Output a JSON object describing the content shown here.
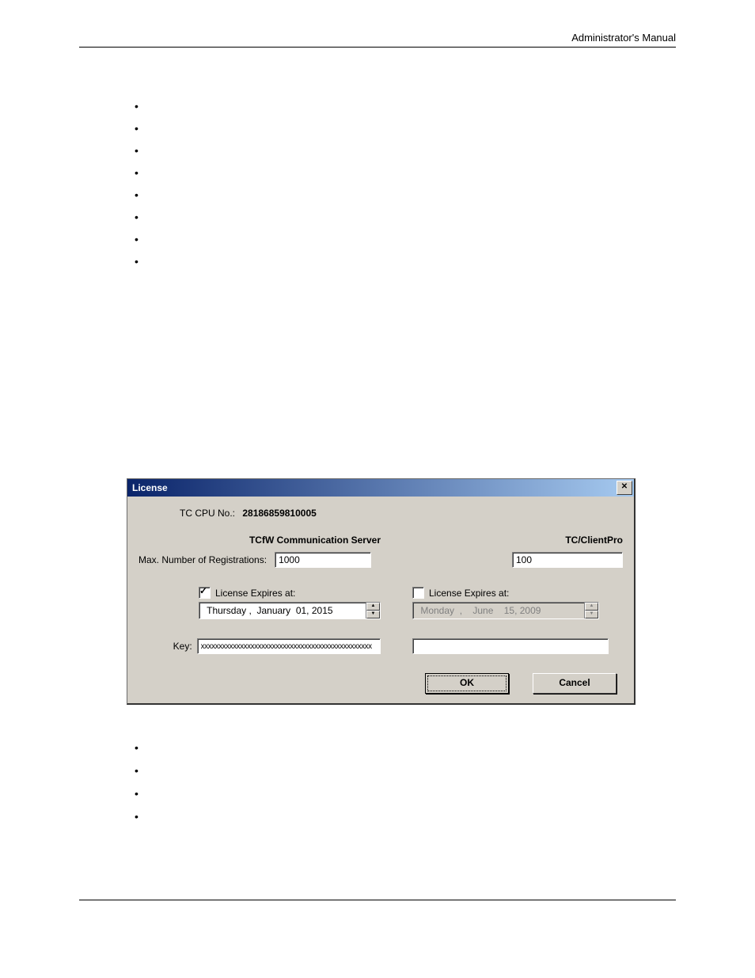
{
  "header": {
    "title": "Administrator's Manual"
  },
  "bullets_top": [
    "",
    "",
    "",
    "",
    "",
    "",
    "",
    ""
  ],
  "bullets_bottom": [
    "",
    "",
    "",
    ""
  ],
  "dialog": {
    "title": "License",
    "cpu_label": "TC CPU No.:",
    "cpu_value": "28186859810005",
    "left": {
      "title": "TCfW Communication Server",
      "reg_label": "Max. Number of Registrations:",
      "reg_value": "1000",
      "expire_checked": true,
      "expire_label": "License Expires at:",
      "date_text": " Thursday ,  January  01, 2015",
      "key_label": "Key:",
      "key_value": "xxxxxxxxxxxxxxxxxxxxxxxxxxxxxxxxxxxxxxxxxxxxxxxx"
    },
    "right": {
      "title": "TC/ClientPro",
      "reg_value": "100",
      "expire_checked": false,
      "expire_label": "License Expires at:",
      "date_text": " Monday  ,    June    15, 2009",
      "key_value": ""
    },
    "ok": "OK",
    "cancel": "Cancel"
  }
}
